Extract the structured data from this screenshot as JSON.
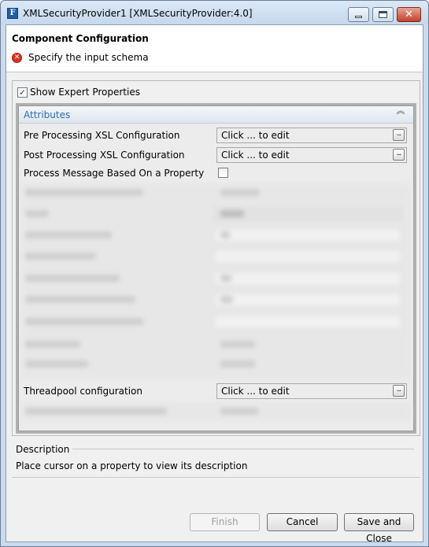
{
  "window": {
    "app_icon": "F",
    "title": "XMLSecurityProvider1 [XMLSecurityProvider:4.0]",
    "close_glyph": "✕"
  },
  "header": {
    "title": "Component Configuration",
    "error_icon": "✕",
    "message": "Specify the input schema"
  },
  "expert": {
    "label": "Show Expert Properties",
    "checked": true,
    "check_glyph": "✓"
  },
  "attributes": {
    "title": "Attributes",
    "collapse_glyph": "︽",
    "properties": [
      {
        "label": "Pre Processing XSL Configuration",
        "value": "Click ... to edit",
        "button": "..."
      },
      {
        "label": "Post Processing XSL Configuration",
        "value": "Click ... to edit",
        "button": "..."
      },
      {
        "label": "Process Message Based On a Property",
        "checked": false
      },
      {
        "label": "Threadpool configuration",
        "value": "Click ... to edit",
        "button": "..."
      }
    ]
  },
  "description": {
    "legend": "Description",
    "text": "Place cursor on a property to view its description"
  },
  "buttons": {
    "finish": "Finish",
    "cancel": "Cancel",
    "save_close": "Save and Close"
  },
  "colors": {
    "accent": "#2e6ab1",
    "error": "#d9341f",
    "titlebar": "#c6d8ec"
  }
}
